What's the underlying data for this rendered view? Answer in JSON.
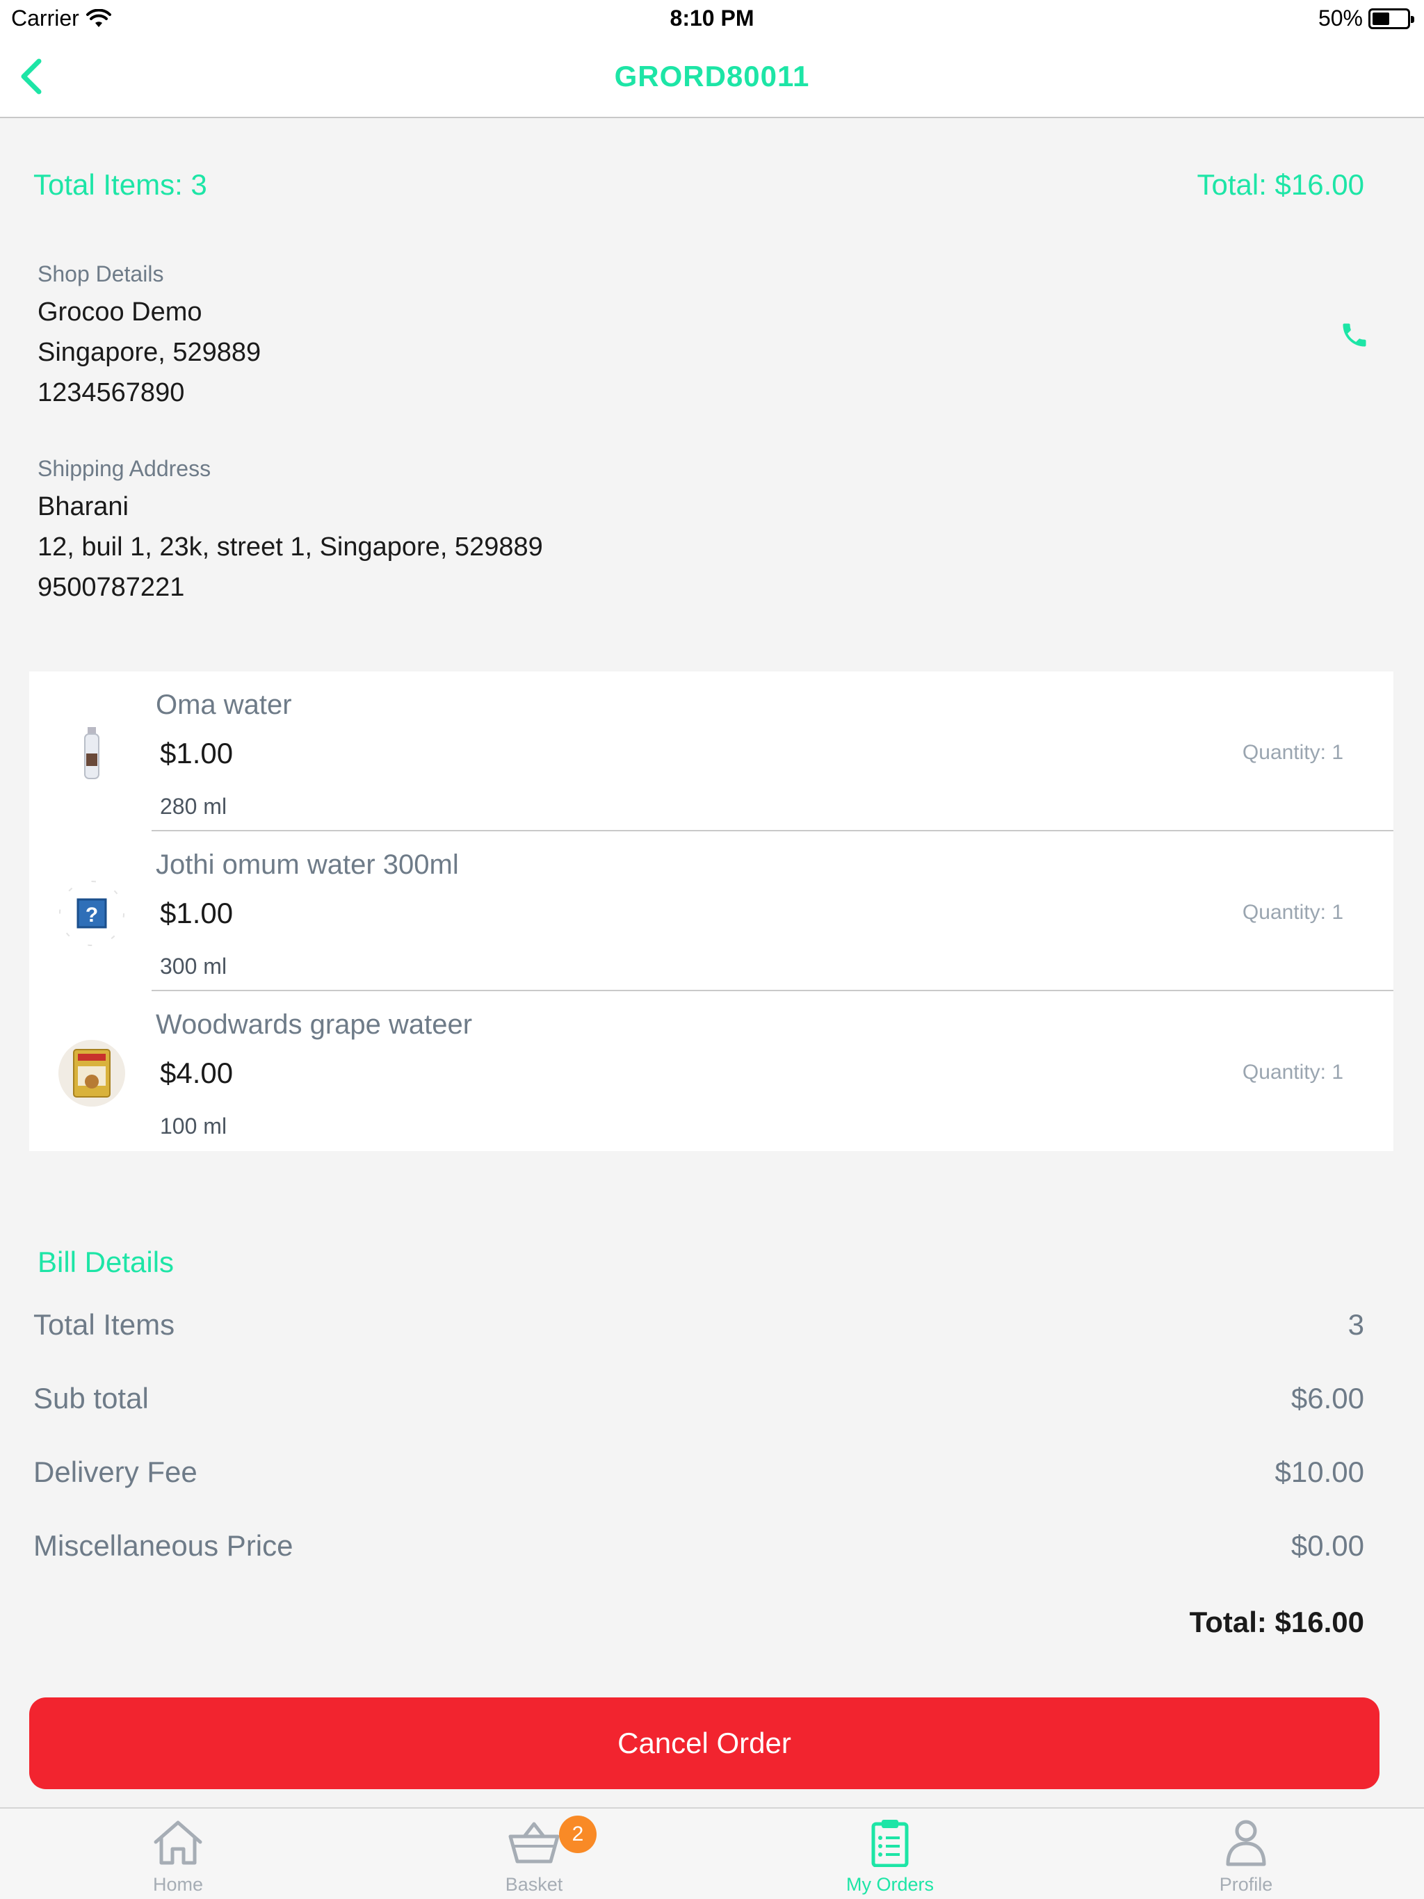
{
  "status_bar": {
    "carrier": "Carrier",
    "time": "8:10 PM",
    "battery": "50%",
    "battery_level": 0.5
  },
  "nav": {
    "title": "GRORD80011"
  },
  "summary": {
    "total_items": "Total Items: 3",
    "total": "Total: $16.00"
  },
  "shop": {
    "label": "Shop Details",
    "name": "Grocoo Demo",
    "location": "Singapore, 529889",
    "phone": "1234567890"
  },
  "shipping": {
    "label": "Shipping Address",
    "name": "Bharani",
    "address": "12, buil 1, 23k, street 1, Singapore, 529889",
    "phone": "9500787221"
  },
  "items": [
    {
      "name": "Oma water",
      "price": "$1.00",
      "unit": "280 ml",
      "quantity": "Quantity: 1"
    },
    {
      "name": "Jothi omum water 300ml",
      "price": "$1.00",
      "unit": "300 ml",
      "quantity": "Quantity: 1"
    },
    {
      "name": "Woodwards grape wateer",
      "price": "$4.00",
      "unit": "100 ml",
      "quantity": "Quantity: 1"
    }
  ],
  "bill": {
    "title": "Bill Details",
    "rows": [
      {
        "label": "Total Items",
        "value": "3"
      },
      {
        "label": "Sub total",
        "value": "$6.00"
      },
      {
        "label": "Delivery Fee",
        "value": "$10.00"
      },
      {
        "label": "Miscellaneous Price",
        "value": "$0.00"
      }
    ],
    "total": "Total: $16.00"
  },
  "cancel_button": "Cancel Order",
  "tabs": [
    {
      "label": "Home",
      "icon": "home-icon"
    },
    {
      "label": "Basket",
      "icon": "basket-icon",
      "badge": "2"
    },
    {
      "label": "My Orders",
      "icon": "clipboard-icon"
    },
    {
      "label": "Profile",
      "icon": "profile-icon"
    }
  ],
  "colors": {
    "accent": "#1de5a6",
    "danger": "#f2242f",
    "badge": "#f98a26"
  }
}
